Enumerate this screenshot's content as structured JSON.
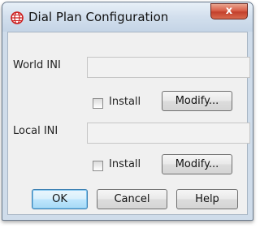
{
  "window": {
    "title": "Dial Plan Configuration",
    "close_glyph": "x",
    "app_icon": "globe-icon"
  },
  "world_ini": {
    "label": "World INI",
    "value": "",
    "install_label": "Install",
    "install_checked": false,
    "modify_label": "Modify..."
  },
  "local_ini": {
    "label": "Local INI",
    "value": "",
    "install_label": "Install",
    "install_checked": false,
    "modify_label": "Modify..."
  },
  "buttons": {
    "ok": "OK",
    "cancel": "Cancel",
    "help": "Help"
  },
  "colors": {
    "close_button": "#c3402c",
    "title_bar": "#d2dfed",
    "icon_red": "#cc1a1a",
    "default_button_border": "#3c7fb1"
  }
}
